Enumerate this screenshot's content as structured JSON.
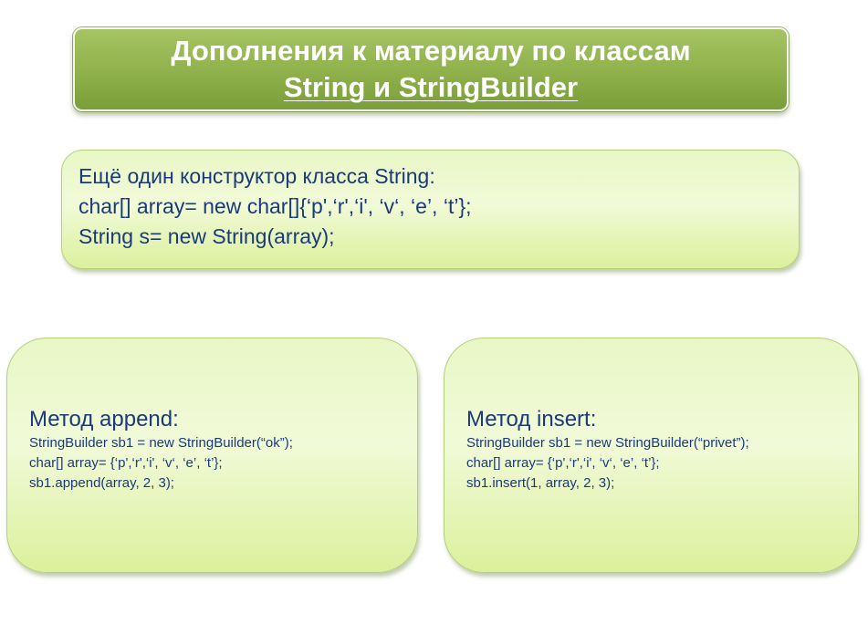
{
  "title": {
    "line1": "Дополнения к материалу по классам",
    "line2": "String и StringBuilder"
  },
  "constructor_box": {
    "lines": [
      "Ещё один конструктор класса String:",
      "char[] array= new char[]{‘p',‘r',‘i', ‘v‘, ‘e’, ‘t’};",
      "String s= new String(array);"
    ]
  },
  "append_box": {
    "heading": "Метод append:",
    "lines": [
      "StringBuilder sb1 = new StringBuilder(“ok”);",
      "char[] array= {‘p',‘r',‘i', ‘v‘, ‘e’, ‘t’};",
      "sb1.append(array, 2, 3);"
    ]
  },
  "insert_box": {
    "heading": "Метод insert:",
    "lines": [
      "StringBuilder sb1 = new StringBuilder(“privet”);",
      "char[] array= {‘p',‘r',‘i', ‘v‘, ‘e’, ‘t’};",
      "sb1.insert(1, array, 2, 3);"
    ]
  },
  "colors": {
    "title_fill": "#8fb04a",
    "title_text": "#ffffff",
    "box_fill": "#e9f7c6",
    "box_text": "#1a3a7a"
  }
}
